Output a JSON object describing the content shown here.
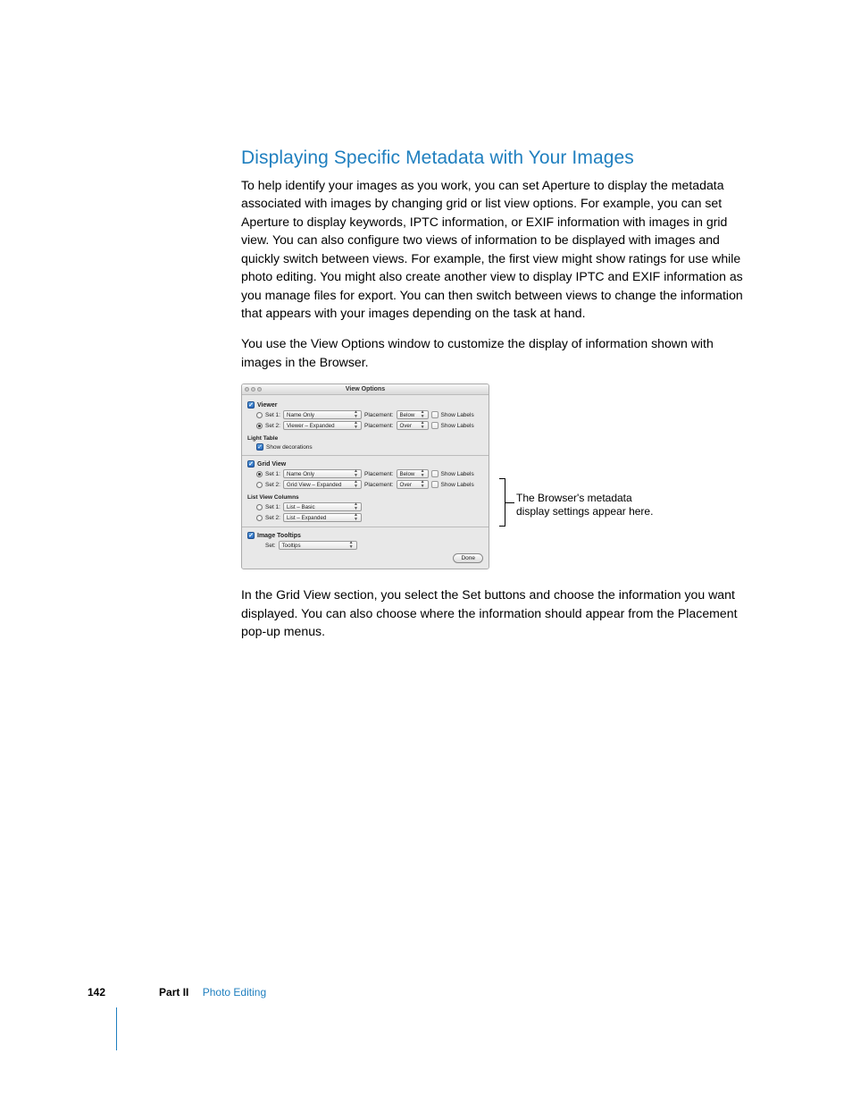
{
  "heading": "Displaying Specific Metadata with Your Images",
  "para1": "To help identify your images as you work, you can set Aperture to display the metadata associated with images by changing grid or list view options. For example, you can set Aperture to display keywords, IPTC information, or EXIF information with images in grid view. You can also configure two views of information to be displayed with images and quickly switch between views. For example, the first view might show ratings for use while photo editing. You might also create another view to display IPTC and EXIF information as you manage files for export. You can then switch between views to change the information that appears with your images depending on the task at hand.",
  "para2": "You use the View Options window to customize the display of information shown with images in the Browser.",
  "para3": "In the Grid View section, you select the Set buttons and choose the information you want displayed. You can also choose where the information should appear from the Placement pop-up menus.",
  "callout": "The Browser's metadata display settings appear here.",
  "dialog": {
    "title": "View Options",
    "viewer": {
      "label": "Viewer",
      "set1": {
        "label": "Set 1:",
        "value": "Name Only",
        "placement_label": "Placement:",
        "placement": "Below",
        "show_labels": "Show Labels"
      },
      "set2": {
        "label": "Set 2:",
        "value": "Viewer – Expanded",
        "placement_label": "Placement:",
        "placement": "Over",
        "show_labels": "Show Labels"
      }
    },
    "light_table": {
      "label": "Light Table",
      "show_decorations": "Show decorations"
    },
    "grid_view": {
      "label": "Grid View",
      "set1": {
        "label": "Set 1:",
        "value": "Name Only",
        "placement_label": "Placement:",
        "placement": "Below",
        "show_labels": "Show Labels"
      },
      "set2": {
        "label": "Set 2:",
        "value": "Grid View – Expanded",
        "placement_label": "Placement:",
        "placement": "Over",
        "show_labels": "Show Labels"
      }
    },
    "list_view": {
      "label": "List View Columns",
      "set1": {
        "label": "Set 1:",
        "value": "List – Basic"
      },
      "set2": {
        "label": "Set 2:",
        "value": "List – Expanded"
      }
    },
    "tooltips": {
      "label": "Image Tooltips",
      "set": {
        "label": "Set:",
        "value": "Tooltips"
      }
    },
    "done": "Done"
  },
  "footer": {
    "page": "142",
    "part_label": "Part II",
    "part_name": "Photo Editing"
  }
}
